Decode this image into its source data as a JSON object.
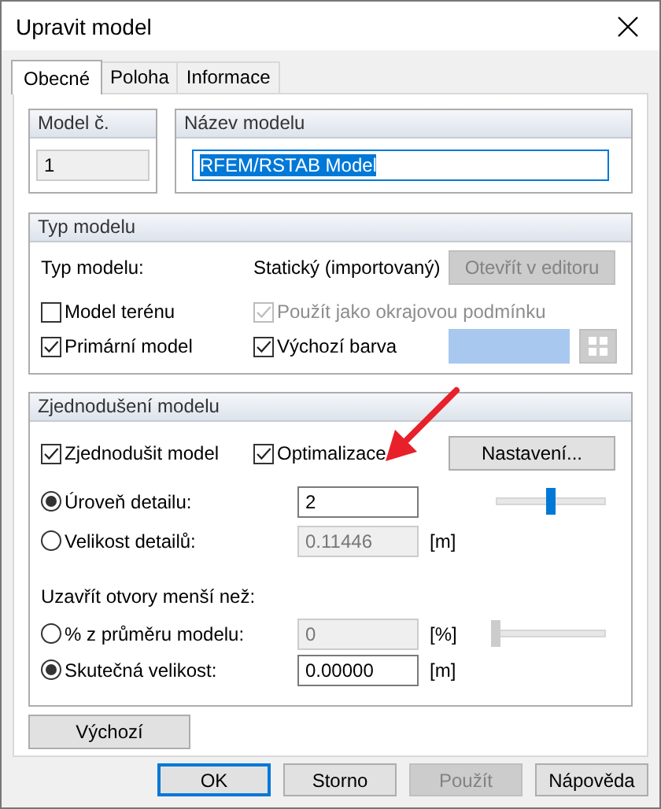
{
  "window": {
    "title": "Upravit model"
  },
  "tabs": [
    {
      "label": "Obecné",
      "selected": true
    },
    {
      "label": "Poloha",
      "selected": false
    },
    {
      "label": "Informace",
      "selected": false
    }
  ],
  "model_number": {
    "label": "Model č.",
    "value": "1"
  },
  "model_name": {
    "label": "Název modelu",
    "value": "RFEM/RSTAB Model",
    "selected": true
  },
  "model_type": {
    "title": "Typ modelu",
    "type_label": "Typ modelu:",
    "type_value": "Statický (importovaný)",
    "editor_button": {
      "label": "Otevřít v editoru",
      "disabled": true
    },
    "checkboxes": [
      {
        "label": "Model terénu",
        "checked": false,
        "disabled": false
      },
      {
        "label": "Použít jako okrajovou podmínku",
        "checked": true,
        "disabled": true
      },
      {
        "label": "Primární model",
        "checked": true,
        "disabled": false
      },
      {
        "label": "Výchozí barva",
        "checked": true,
        "disabled": false
      }
    ],
    "color": "#a8c8f0"
  },
  "simplification": {
    "title": "Zjednodušení modelu",
    "checkboxes": [
      {
        "label": "Zjednodušit model",
        "checked": true
      },
      {
        "label": "Optimalizace",
        "checked": true
      }
    ],
    "settings_button": "Nastavení...",
    "detail_rows": [
      {
        "label": "Úroveň detailu:",
        "selected": true,
        "value": "2",
        "disabled": false,
        "level": 0.5
      },
      {
        "label": "Velikost detailů:",
        "selected": false,
        "value": "0.11446",
        "disabled": true,
        "unit": "[m]"
      }
    ],
    "close_label": "Uzavřít otvory menší než:",
    "close_rows": [
      {
        "label": "% z průměru modelu:",
        "selected": false,
        "value": "0",
        "disabled": true,
        "unit": "[%]",
        "level": 0
      },
      {
        "label": "Skutečná velikost:",
        "selected": true,
        "value": "0.00000",
        "disabled": false,
        "unit": "[m]"
      }
    ]
  },
  "default_button": "Výchozí",
  "buttons": [
    {
      "label": "OK",
      "default": true,
      "disabled": false
    },
    {
      "label": "Storno",
      "default": false,
      "disabled": false
    },
    {
      "label": "Použít",
      "default": false,
      "disabled": true
    },
    {
      "label": "Nápověda",
      "default": false,
      "disabled": false
    }
  ]
}
